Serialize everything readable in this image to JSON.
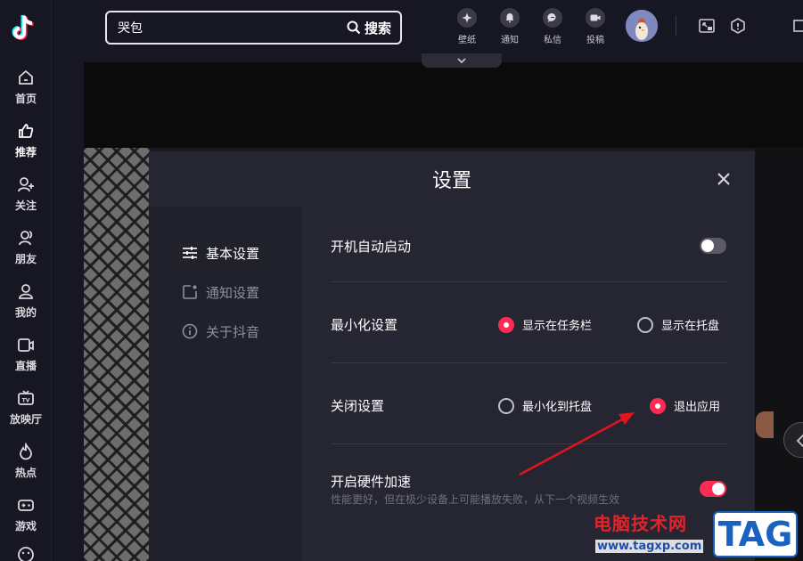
{
  "app": {
    "name": "抖音"
  },
  "sidebar": {
    "items": [
      {
        "label": "首页",
        "icon": "home-icon"
      },
      {
        "label": "推荐",
        "icon": "thumbs-up-icon",
        "active": true
      },
      {
        "label": "关注",
        "icon": "user-plus-icon"
      },
      {
        "label": "朋友",
        "icon": "friends-icon"
      },
      {
        "label": "我的",
        "icon": "user-icon"
      },
      {
        "label": "直播",
        "icon": "live-camera-icon"
      },
      {
        "label": "放映厅",
        "icon": "tv-icon"
      },
      {
        "label": "热点",
        "icon": "flame-icon"
      },
      {
        "label": "游戏",
        "icon": "gamepad-icon"
      }
    ]
  },
  "search": {
    "value": "哭包",
    "button_label": "搜索"
  },
  "topbar": {
    "buttons": [
      {
        "label": "壁纸",
        "icon": "wallpaper-icon"
      },
      {
        "label": "通知",
        "icon": "bell-icon"
      },
      {
        "label": "私信",
        "icon": "message-icon"
      },
      {
        "label": "投稿",
        "icon": "upload-video-icon"
      }
    ]
  },
  "settings": {
    "title": "设置",
    "menu": [
      {
        "label": "基本设置",
        "icon": "sliders-icon",
        "active": true
      },
      {
        "label": "通知设置",
        "icon": "notification-icon"
      },
      {
        "label": "关于抖音",
        "icon": "info-icon"
      }
    ],
    "autostart": {
      "label": "开机自动启动",
      "enabled": false
    },
    "minimize": {
      "label": "最小化设置",
      "options": [
        "显示在任务栏",
        "显示在托盘"
      ],
      "selected": "显示在任务栏"
    },
    "close": {
      "label": "关闭设置",
      "options": [
        "最小化到托盘",
        "退出应用"
      ],
      "selected": "退出应用"
    },
    "hardware": {
      "label": "开启硬件加速",
      "description": "性能更好，但在极少设备上可能播放失败，从下一个视频生效",
      "enabled": true
    }
  },
  "watermark": {
    "site_name": "电脑技术网",
    "url": "www.tagxp.com",
    "tag": "TAG"
  },
  "colors": {
    "accent": "#fe2c55",
    "background": "#161722",
    "modal": "#252632",
    "annotation": "#e3141b"
  }
}
